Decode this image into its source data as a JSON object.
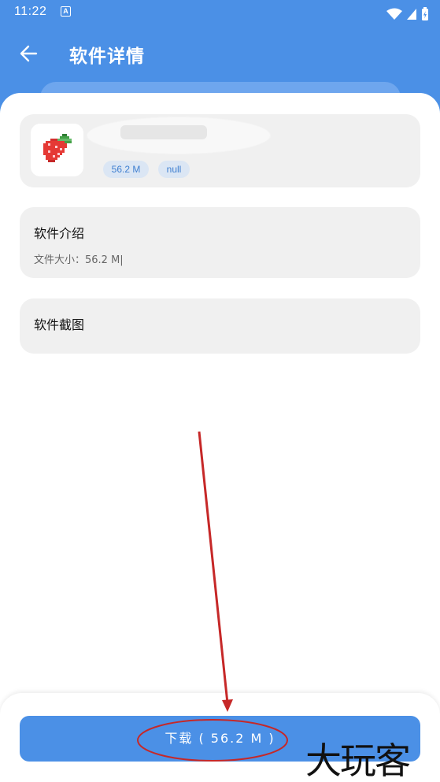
{
  "status_bar": {
    "time": "11:22",
    "notification_letter": "A"
  },
  "toolbar": {
    "title": "软件详情"
  },
  "app": {
    "name": "",
    "size_badge": "56.2 M",
    "extra_badge": "null"
  },
  "intro": {
    "title": "软件介绍",
    "file_size_text": "文件大小：56.2 M|"
  },
  "screenshots": {
    "title": "软件截图"
  },
  "download": {
    "label": "下载 ( 56.2 M )"
  },
  "watermark": {
    "text": "大玩客"
  },
  "colors": {
    "primary": "#4b90e6",
    "card_bg": "#f0f0f0",
    "badge_bg": "#dbe6f4",
    "badge_text": "#3f7fd0",
    "annotation_red": "#c62828"
  }
}
